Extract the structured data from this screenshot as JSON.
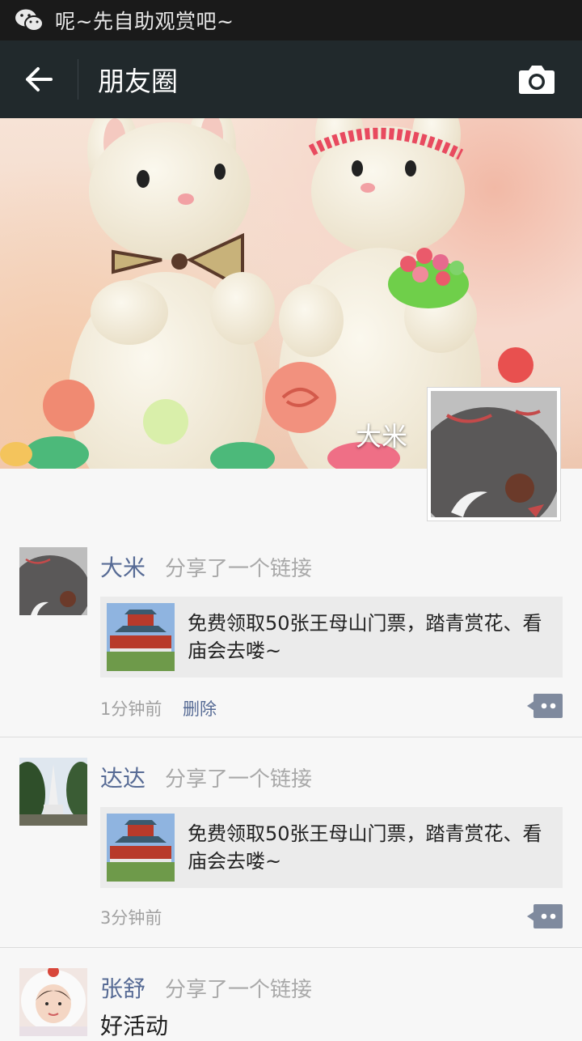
{
  "status_bar": {
    "notification_text": "呢~先自助观赏吧~"
  },
  "header": {
    "title": "朋友圈"
  },
  "profile": {
    "name": "大米"
  },
  "posts": [
    {
      "name": "大米",
      "action": "分享了一个链接",
      "link_text": "免费领取50张王母山门票，踏青赏花、看庙会去喽~",
      "time": "1分钟前",
      "delete_label": "删除"
    },
    {
      "name": "达达",
      "action": "分享了一个链接",
      "link_text": "免费领取50张王母山门票，踏青赏花、看庙会去喽~",
      "time": "3分钟前"
    },
    {
      "name": "张舒",
      "action": "分享了一个链接",
      "text": "好活动"
    }
  ],
  "colors": {
    "header_bg": "#21292c",
    "status_bg": "#1a1a1a",
    "link_blue": "#576b95",
    "card_bg": "#ebebeb"
  },
  "icons": [
    "wechat-icon",
    "back-arrow-icon",
    "camera-icon",
    "comment-icon"
  ]
}
